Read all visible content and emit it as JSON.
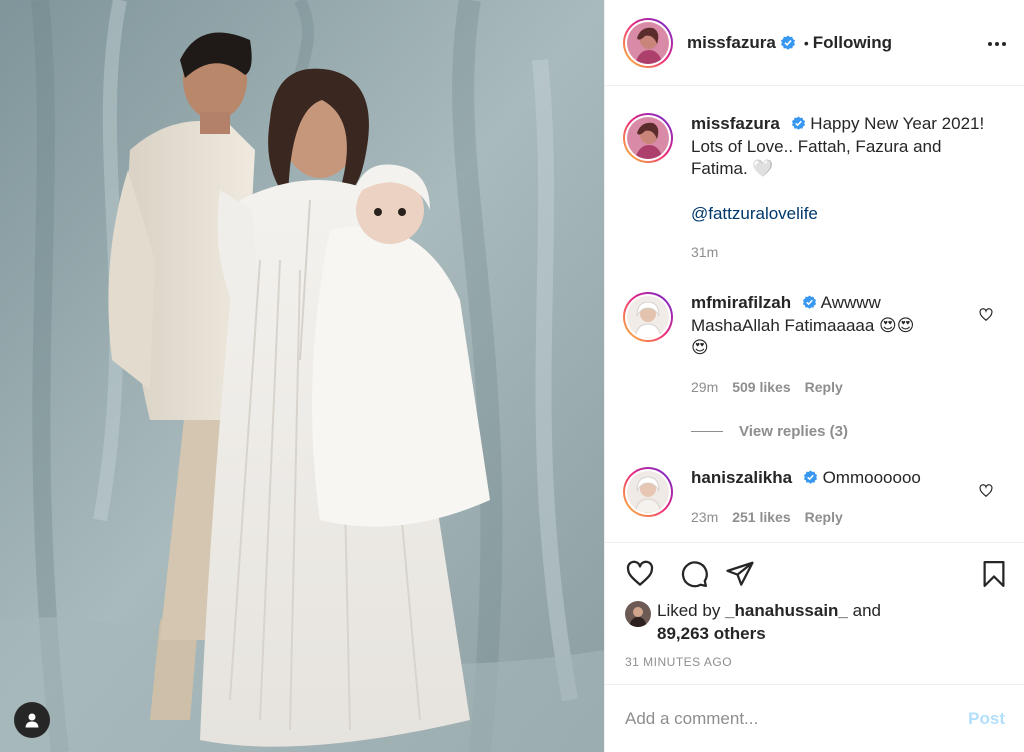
{
  "post": {
    "author": "missfazura",
    "follow_status": "Following",
    "separator": "•",
    "caption": "Happy New Year 2021! Lots of Love.. Fattah, Fazura and Fatima. 🤍",
    "mention": "@fattzuralovelife",
    "caption_time": "31m"
  },
  "comments": [
    {
      "user": "mfmirafilzah",
      "text": "Awwww MashaAllah Fatimaaaaa 😍😍",
      "emoji_line": "😍",
      "time": "29m",
      "likes": "509 likes",
      "reply": "Reply",
      "view_replies": "View replies (3)"
    },
    {
      "user": "haniszalikha",
      "text": "Ommoooooo",
      "time": "23m",
      "likes": "251 likes",
      "reply": "Reply"
    }
  ],
  "likes": {
    "prefix": "Liked by",
    "user": "_hanahussain_",
    "and": "and",
    "others": "89,263 others"
  },
  "timestamp": "31 MINUTES AGO",
  "add_comment": {
    "placeholder": "Add a comment...",
    "post_label": "Post"
  },
  "colors": {
    "verified": "#3897f0",
    "link": "#00376b",
    "post_disabled": "#b2dffc",
    "muted": "#8e8e8e",
    "backdrop": "#8fa2a6"
  },
  "icons": [
    "verified-icon",
    "more-icon",
    "heart-icon",
    "comment-icon",
    "share-icon",
    "bookmark-icon",
    "user-tag-icon"
  ]
}
